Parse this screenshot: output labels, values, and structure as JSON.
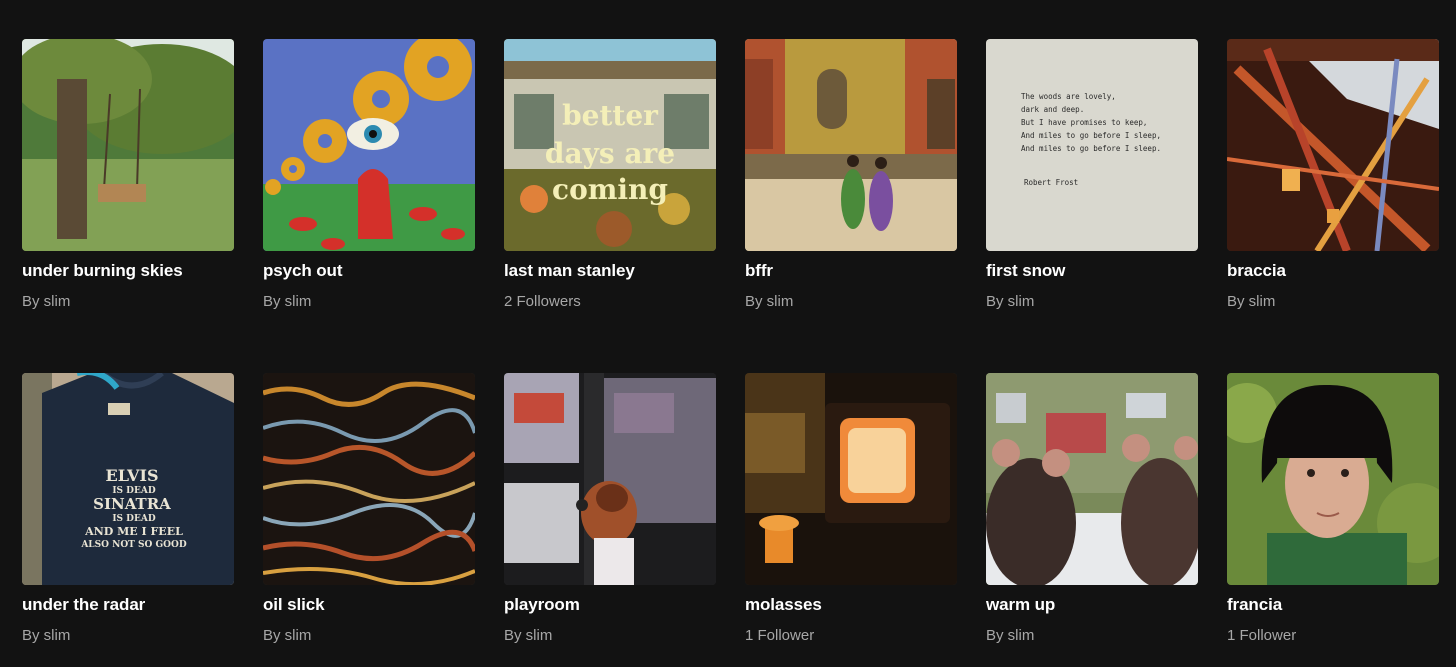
{
  "playlists": [
    {
      "title": "under burning skies",
      "subtitle": "By slim",
      "art": "tree-swing-photo"
    },
    {
      "title": "psych out",
      "subtitle": "By slim",
      "art": "psychedelic-donut-illustration"
    },
    {
      "title": "last man stanley",
      "subtitle": "2 Followers",
      "art": "storefront-photo",
      "art_text": [
        "better",
        "days are",
        "coming"
      ]
    },
    {
      "title": "bffr",
      "subtitle": "By slim",
      "art": "street-walkers-photo"
    },
    {
      "title": "first snow",
      "subtitle": "By slim",
      "art": "typewritten-poem",
      "art_text": [
        "The woods are lovely,",
        "dark and deep.",
        "But I have promises to keep,",
        "And miles to go before I sleep,",
        "And miles to go before I sleep.",
        "Robert Frost"
      ]
    },
    {
      "title": "braccia",
      "subtitle": "By slim",
      "art": "thread-installation-photo"
    },
    {
      "title": "under the radar",
      "subtitle": "By slim",
      "art": "tshirt-photo",
      "art_text": [
        "ELVIS",
        "IS DEAD",
        "SINATRA",
        "IS DEAD",
        "AND ME I FEEL",
        "ALSO NOT SO GOOD"
      ]
    },
    {
      "title": "oil slick",
      "subtitle": "By slim",
      "art": "water-reflection-photo"
    },
    {
      "title": "playroom",
      "subtitle": "By slim",
      "art": "orangutan-bus-photo"
    },
    {
      "title": "molasses",
      "subtitle": "1 Follower",
      "art": "glowing-tv-photo"
    },
    {
      "title": "warm up",
      "subtitle": "By slim",
      "art": "rats-window-photo"
    },
    {
      "title": "francia",
      "subtitle": "1 Follower",
      "art": "portrait-photo"
    }
  ]
}
